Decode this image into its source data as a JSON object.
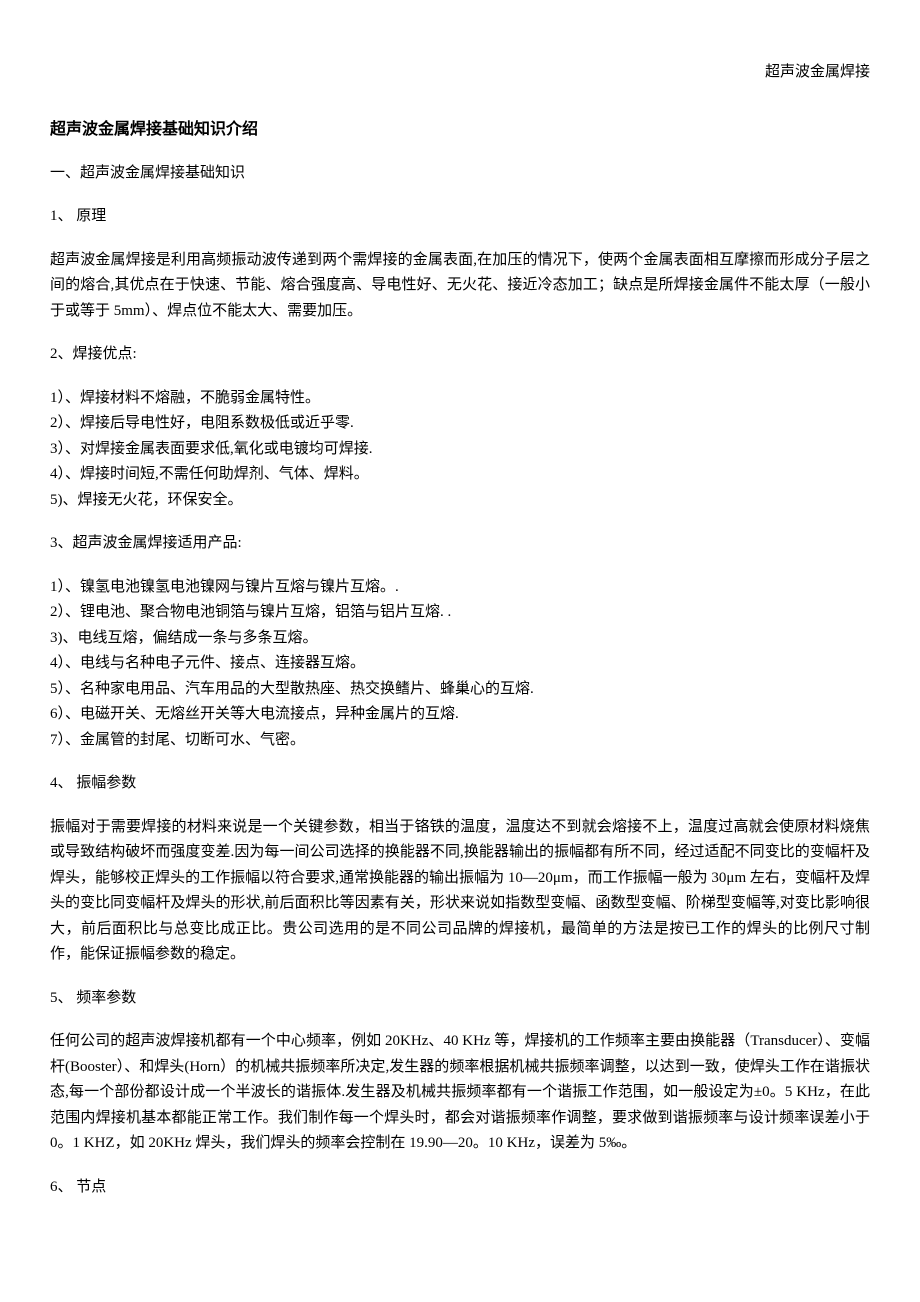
{
  "header_right": "超声波金属焊接",
  "title": "超声波金属焊接基础知识介绍",
  "intro": "一、超声波金属焊接基础知识",
  "sections": {
    "s1": {
      "heading": "1、 原理",
      "paragraph": "超声波金属焊接是利用高频振动波传递到两个需焊接的金属表面,在加压的情况下，使两个金属表面相互摩擦而形成分子层之间的熔合,其优点在于快速、节能、熔合强度高、导电性好、无火花、接近冷态加工；缺点是所焊接金属件不能太厚（一般小于或等于 5mm）、焊点位不能太大、需要加压。"
    },
    "s2": {
      "heading": "2、焊接优点:",
      "items": [
        "1）、焊接材料不熔融，不脆弱金属特性。",
        "2）、焊接后导电性好，电阻系数极低或近乎零.",
        "3）、对焊接金属表面要求低,氧化或电镀均可焊接.",
        "4）、焊接时间短,不需任何助焊剂、气体、焊料。",
        "5)、焊接无火花，环保安全。"
      ]
    },
    "s3": {
      "heading": "3、超声波金属焊接适用产品:",
      "items": [
        "1）、镍氢电池镍氢电池镍网与镍片互熔与镍片互熔。.",
        "2）、锂电池、聚合物电池铜箔与镍片互熔，铝箔与铝片互熔. .",
        "3)、电线互熔，偏结成一条与多条互熔。",
        "4）、电线与名种电子元件、接点、连接器互熔。",
        "5）、名种家电用品、汽车用品的大型散热座、热交换鳍片、蜂巢心的互熔.",
        "6）、电磁开关、无熔丝开关等大电流接点，异种金属片的互熔.",
        "7）、金属管的封尾、切断可水、气密。"
      ]
    },
    "s4": {
      "heading": "4、 振幅参数",
      "paragraph": "振幅对于需要焊接的材料来说是一个关键参数，相当于铬铁的温度，温度达不到就会熔接不上，温度过高就会使原材料烧焦或导致结构破坏而强度变差.因为每一间公司选择的换能器不同,换能器输出的振幅都有所不同，经过适配不同变比的变幅杆及焊头，能够校正焊头的工作振幅以符合要求,通常换能器的输出振幅为 10—20μm，而工作振幅一般为 30μm 左右，变幅杆及焊头的变比同变幅杆及焊头的形状,前后面积比等因素有关，形状来说如指数型变幅、函数型变幅、阶梯型变幅等,对变比影响很大，前后面积比与总变比成正比。贵公司选用的是不同公司品牌的焊接机，最简单的方法是按已工作的焊头的比例尺寸制作，能保证振幅参数的稳定。"
    },
    "s5": {
      "heading": "5、 频率参数",
      "paragraph": "任何公司的超声波焊接机都有一个中心频率，例如 20KHz、40 KHz 等，焊接机的工作频率主要由换能器（Transducer）、变幅杆(Booster）、和焊头(Horn）的机械共振频率所决定,发生器的频率根据机械共振频率调整，以达到一致，使焊头工作在谐振状态,每一个部份都设计成一个半波长的谐振体.发生器及机械共振频率都有一个谐振工作范围，如一般设定为±0。5 KHz，在此范围内焊接机基本都能正常工作。我们制作每一个焊头时，都会对谐振频率作调整，要求做到谐振频率与设计频率误差小于 0。1 KHZ，如 20KHz 焊头，我们焊头的频率会控制在 19.90—20。10 KHz，误差为 5‰。"
    },
    "s6": {
      "heading": "6、 节点"
    }
  }
}
